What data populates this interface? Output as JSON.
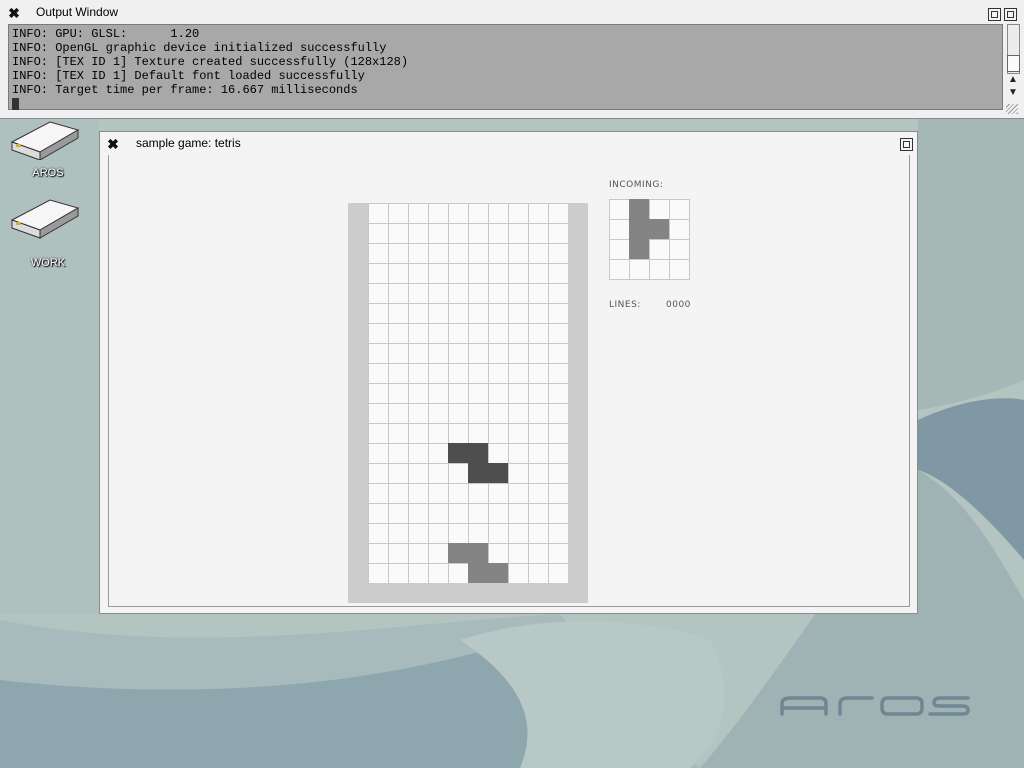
{
  "output_window": {
    "title": "Output Window",
    "lines": [
      "INFO: GPU: GLSL:      1.20",
      "INFO: OpenGL graphic device initialized successfully",
      "INFO: [TEX ID 1] Texture created successfully (128x128)",
      "INFO: [TEX ID 1] Default font loaded successfully",
      "INFO: Target time per frame: 16.667 milliseconds"
    ]
  },
  "desktop": {
    "icons": [
      {
        "label": "AROS"
      },
      {
        "label": "WORK"
      }
    ],
    "logo": "aros"
  },
  "game_window": {
    "title": "sample game: tetris",
    "next_label": "INCOMING:",
    "lines_label": "LINES:",
    "lines_value": "0000",
    "board": {
      "columns": 10,
      "rows": 19,
      "active_piece": {
        "type": "Z",
        "cells": [
          [
            4,
            12
          ],
          [
            5,
            12
          ],
          [
            5,
            13
          ],
          [
            6,
            13
          ]
        ]
      },
      "landed_cells": [
        [
          4,
          17
        ],
        [
          5,
          17
        ],
        [
          5,
          18
        ],
        [
          6,
          18
        ]
      ]
    },
    "next_piece": {
      "type": "T",
      "cells": [
        [
          1,
          0
        ],
        [
          1,
          1
        ],
        [
          2,
          1
        ],
        [
          1,
          2
        ]
      ]
    }
  },
  "colors": {
    "active_piece": "#4e4e4e",
    "landed_piece": "#848484",
    "desktop": "#b4c4c0"
  }
}
